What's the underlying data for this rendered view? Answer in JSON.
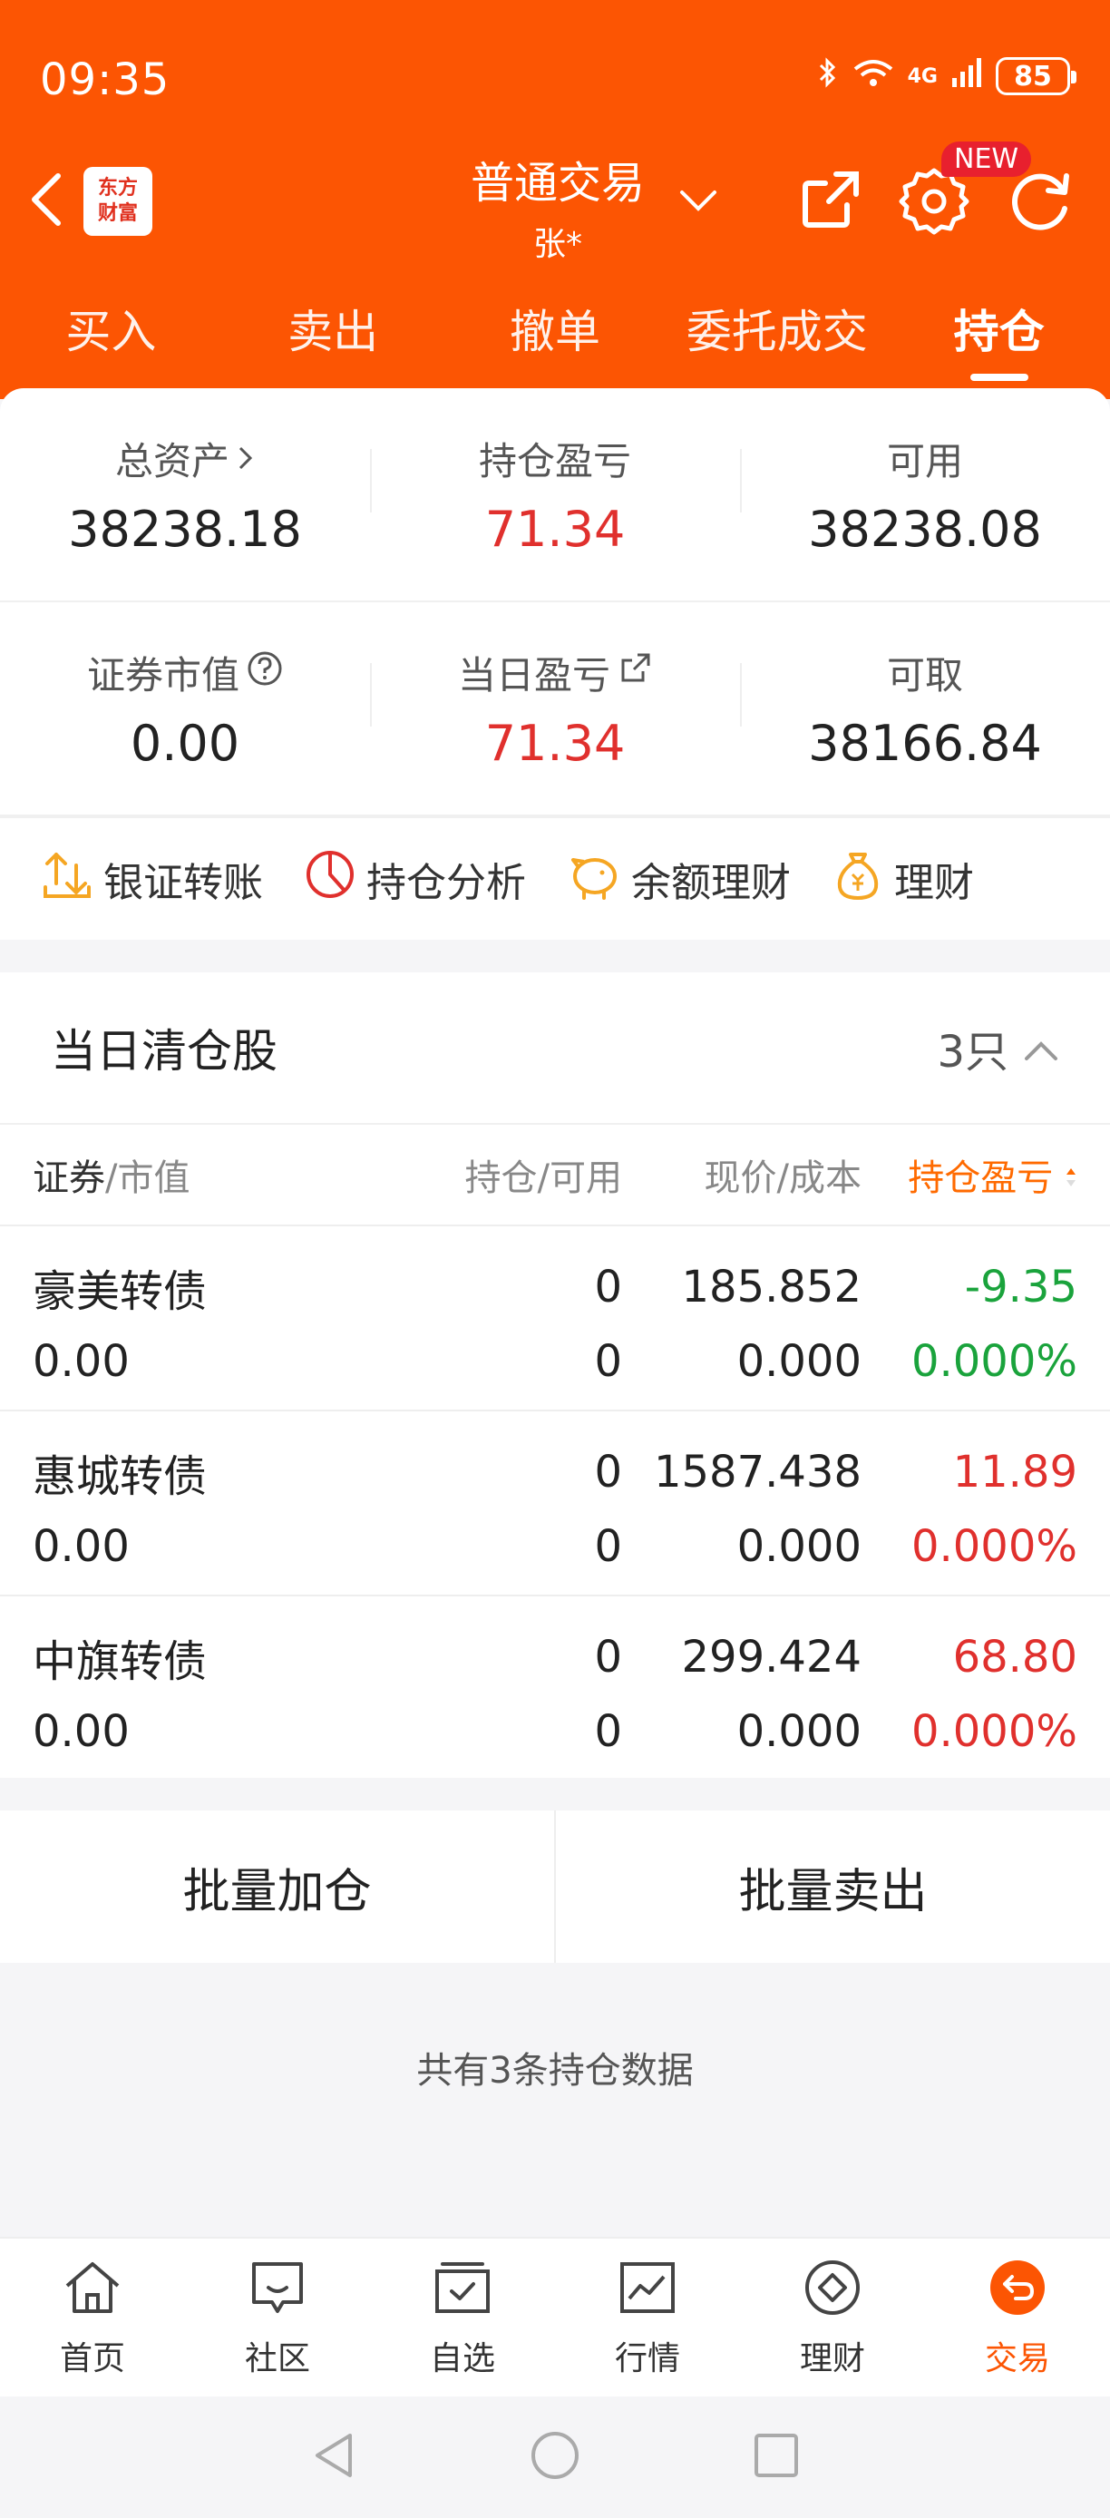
{
  "status": {
    "time": "09:35",
    "network": "4G",
    "battery": "85"
  },
  "header": {
    "logo_line1": "东方",
    "logo_line2": "财富",
    "title": "普通交易",
    "subtitle": "张*",
    "new_badge": "NEW"
  },
  "tabs": [
    {
      "label": "买入"
    },
    {
      "label": "卖出"
    },
    {
      "label": "撤单"
    },
    {
      "label": "委托成交"
    },
    {
      "label": "持仓"
    }
  ],
  "metrics": {
    "total_assets": {
      "label": "总资产",
      "value": "38238.18"
    },
    "position_pnl": {
      "label": "持仓盈亏",
      "value": "71.34"
    },
    "available": {
      "label": "可用",
      "value": "38238.08"
    },
    "securities_value": {
      "label": "证券市值",
      "value": "0.00"
    },
    "daily_pnl": {
      "label": "当日盈亏",
      "value": "71.34"
    },
    "withdrawable": {
      "label": "可取",
      "value": "38166.84"
    }
  },
  "quick_actions": [
    {
      "label": "银证转账"
    },
    {
      "label": "持仓分析"
    },
    {
      "label": "余额理财"
    },
    {
      "label": "理财"
    }
  ],
  "section": {
    "title": "当日清仓股",
    "count": "3只"
  },
  "table": {
    "headers": {
      "security": "证券",
      "market_value": "/市值",
      "position": "持仓/可用",
      "price": "现价/成本",
      "pnl": "持仓盈亏"
    },
    "rows": [
      {
        "name": "豪美转债",
        "market_value": "0.00",
        "position": "0",
        "available": "0",
        "price": "185.852",
        "cost": "0.000",
        "pnl": "-9.35",
        "pnl_pct": "0.000%"
      },
      {
        "name": "惠城转债",
        "market_value": "0.00",
        "position": "0",
        "available": "0",
        "price": "1587.438",
        "cost": "0.000",
        "pnl": "11.89",
        "pnl_pct": "0.000%"
      },
      {
        "name": "中旗转债",
        "market_value": "0.00",
        "position": "0",
        "available": "0",
        "price": "299.424",
        "cost": "0.000",
        "pnl": "68.80",
        "pnl_pct": "0.000%"
      }
    ]
  },
  "actions": {
    "batch_add": "批量加仓",
    "batch_sell": "批量卖出"
  },
  "footer_note": "共有3条持仓数据",
  "bottom_nav": [
    {
      "label": "首页"
    },
    {
      "label": "社区"
    },
    {
      "label": "自选"
    },
    {
      "label": "行情"
    },
    {
      "label": "理财"
    },
    {
      "label": "交易"
    }
  ],
  "colors": {
    "brand": "#fc5503",
    "up": "#e0302d",
    "down": "#1aa33c"
  }
}
